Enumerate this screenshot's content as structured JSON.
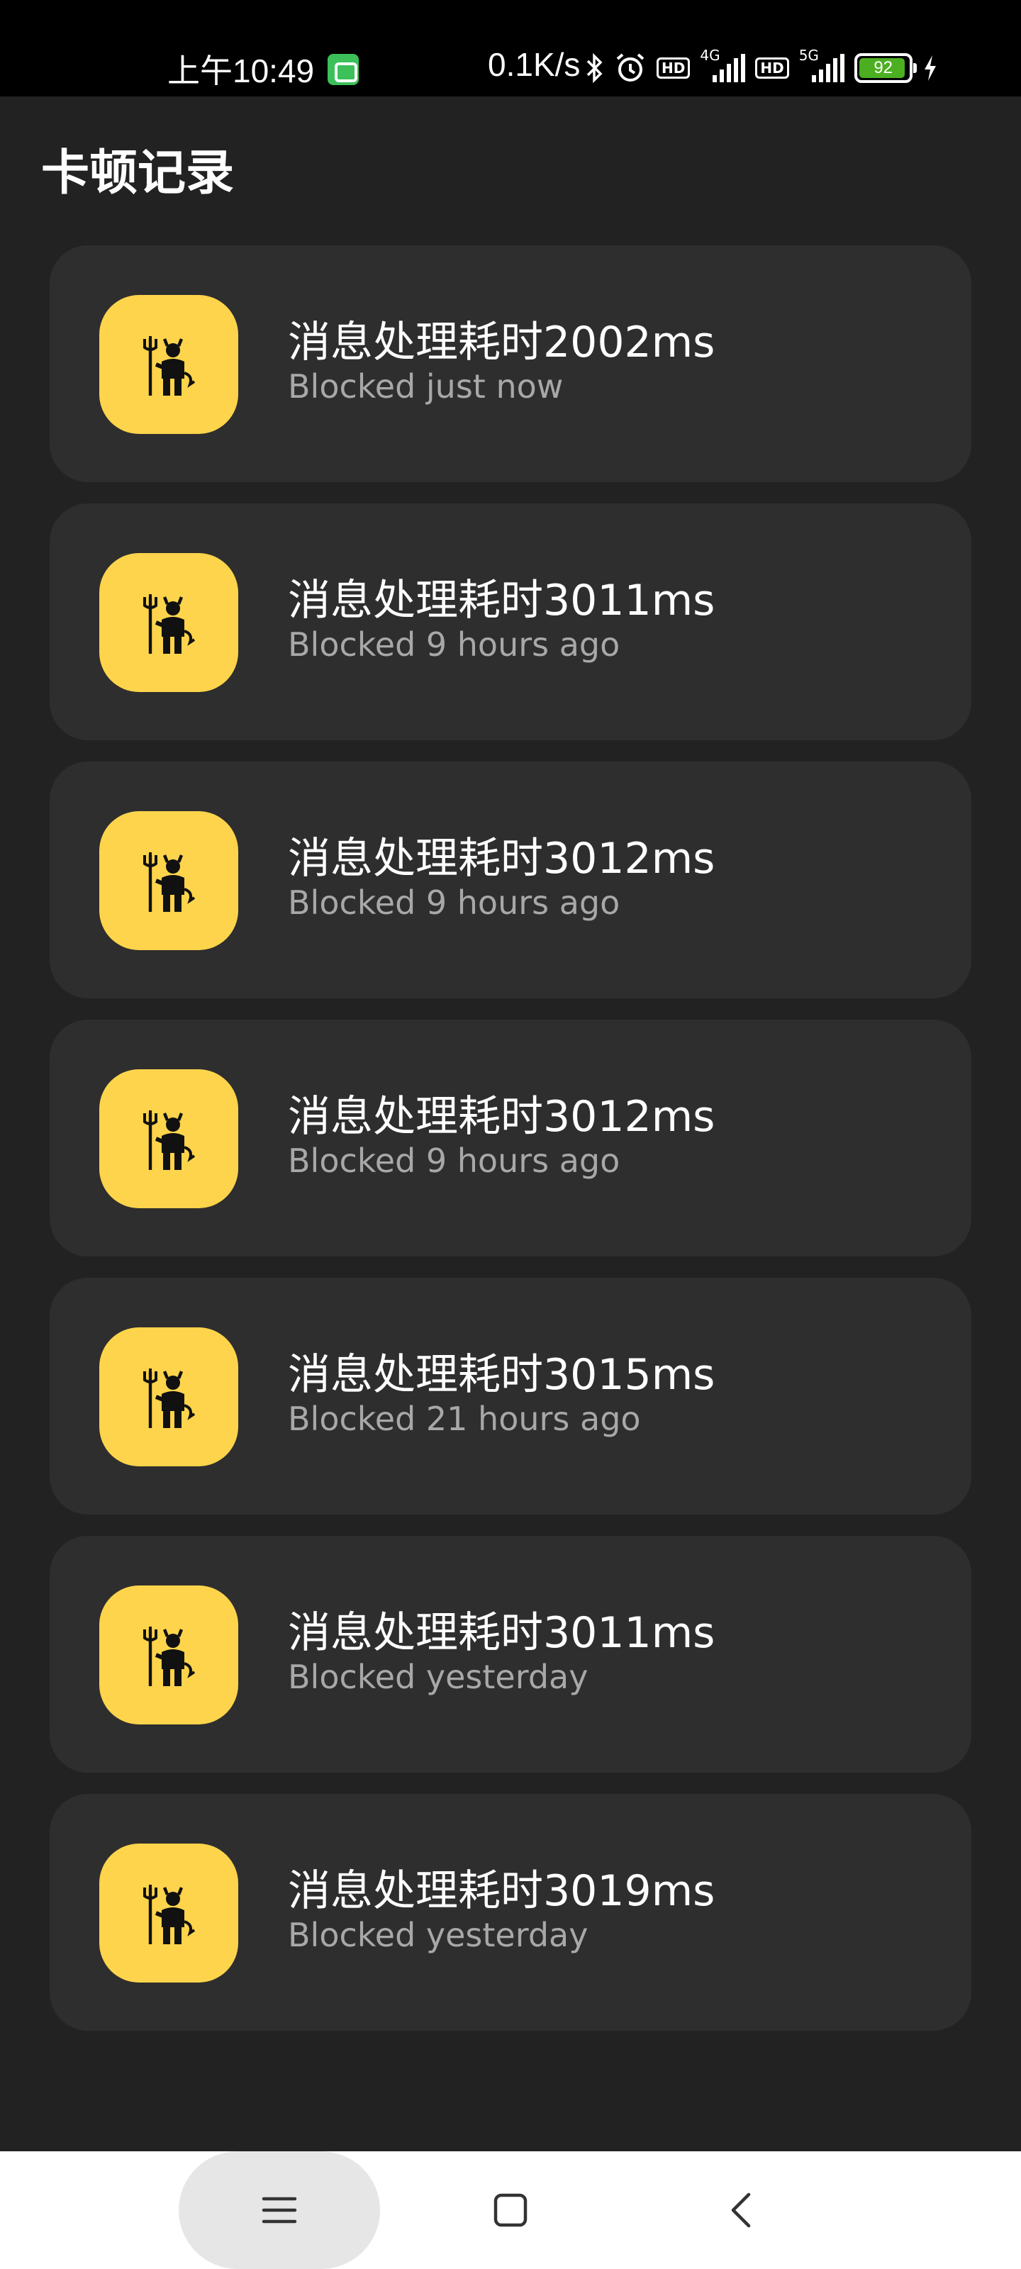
{
  "status_bar": {
    "time": "上午10:49",
    "network_speed": "0.1K/s",
    "sim1_hd": "HD",
    "sim1_net": "4G",
    "sim2_hd": "HD",
    "sim2_net": "5G",
    "battery": "92",
    "icons": [
      "bluetooth-icon",
      "alarm-icon",
      "charging-icon"
    ]
  },
  "header": {
    "title": "卡顿记录"
  },
  "records": [
    {
      "title": "消息处理耗时2002ms",
      "subtitle": "Blocked just now"
    },
    {
      "title": "消息处理耗时3011ms",
      "subtitle": "Blocked 9 hours ago"
    },
    {
      "title": "消息处理耗时3012ms",
      "subtitle": "Blocked 9 hours ago"
    },
    {
      "title": "消息处理耗时3012ms",
      "subtitle": "Blocked 9 hours ago"
    },
    {
      "title": "消息处理耗时3015ms",
      "subtitle": "Blocked 21 hours ago"
    },
    {
      "title": "消息处理耗时3011ms",
      "subtitle": "Blocked yesterday"
    },
    {
      "title": "消息处理耗时3019ms",
      "subtitle": "Blocked yesterday"
    }
  ],
  "nav_bar": {
    "buttons": [
      "menu-icon",
      "home-icon",
      "back-icon"
    ]
  },
  "colors": {
    "background": "#222222",
    "card": "#2e2e2e",
    "avatar": "#fdd44b",
    "subtitle": "#a8a8a8",
    "battery": "#4caf22"
  }
}
